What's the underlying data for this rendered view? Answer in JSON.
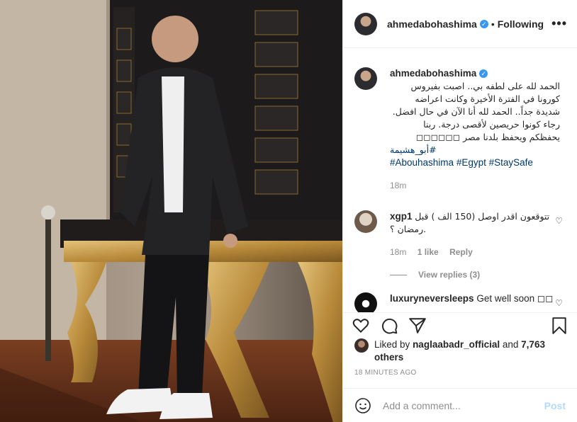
{
  "post": {
    "username": "ahmedabohashima",
    "follow_label": "Following",
    "more": "•••"
  },
  "caption": {
    "username": "ahmedabohashima",
    "text": "الحمد لله على لطفه بي.. اصبت بفيروس كورونا في الفترة الأخيرة وكانت اعراضه شديدة جداً.. الحمد لله أنا الآن في حال افضل. رجاء كونوا حريصين لأقصى درجة. ربنا يحفظكم ويحفظ بلدنا مصر ◻◻◻◻◻◻",
    "hashtag_ar": "#أبو_هشيمة",
    "hashtags": "#Abouhashima #Egypt #StaySafe",
    "time": "18m"
  },
  "comments": [
    {
      "username": "xgp1",
      "text": "تتوقعون اقدر اوصل (150 الف ) قبل رمضان ؟.",
      "time": "18m",
      "likes": "1 like",
      "reply": "Reply",
      "view_replies": "View replies (3)"
    },
    {
      "username": "luxuryneversleeps",
      "text": "Get well soon ◻◻"
    }
  ],
  "liked_by": {
    "prefix": "Liked by",
    "user": "naglaabadr_official",
    "and": "and",
    "others": "7,763 others"
  },
  "time_ago": "18 MINUTES AGO",
  "comment_box": {
    "placeholder": "Add a comment...",
    "post_label": "Post"
  },
  "colors": {
    "verified": "#3897f0",
    "link": "#00376b",
    "muted": "#8e8e8e",
    "post_disabled": "#b3dbff"
  }
}
